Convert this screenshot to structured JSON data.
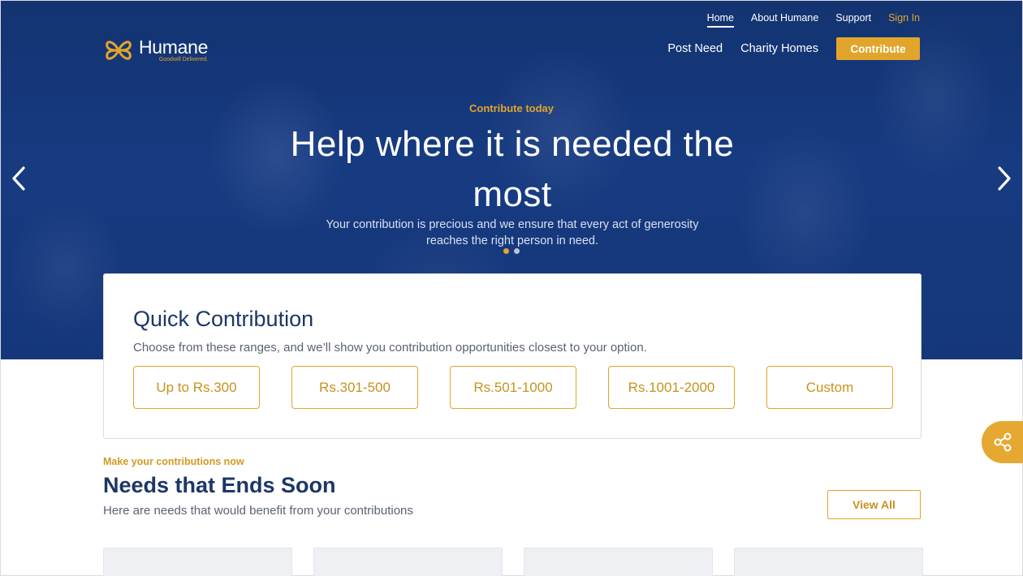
{
  "brand": {
    "name": "Humane",
    "tagline": "Goodwill Delivered."
  },
  "topnav": {
    "home": "Home",
    "about": "About Humane",
    "support": "Support",
    "signin": "Sign In"
  },
  "mainnav": {
    "post_need": "Post Need",
    "charity_homes": "Charity Homes",
    "contribute": "Contribute"
  },
  "hero": {
    "eyebrow": "Contribute today",
    "title": "Help where it is needed the most",
    "subtitle": "Your contribution is precious and we ensure that every act of generosity reaches the right person in need.",
    "slides": 2,
    "active_slide": 1
  },
  "quick_contribution": {
    "title": "Quick Contribution",
    "description": "Choose from these ranges, and we’ll show you contribution opportunities closest to your option.",
    "ranges": [
      "Up to Rs.300",
      "Rs.301-500",
      "Rs.501-1000",
      "Rs.1001-2000",
      "Custom"
    ]
  },
  "needs": {
    "eyebrow": "Make your contributions now",
    "title": "Needs that Ends Soon",
    "description": "Here are needs that would benefit from your contributions",
    "view_all": "View All"
  },
  "colors": {
    "accent": "#e0a52a",
    "navy": "#1c3767",
    "hero_blue": "#1c4591"
  },
  "icons": {
    "prev": "chevron-left-icon",
    "next": "chevron-right-icon",
    "share": "share-icon"
  }
}
